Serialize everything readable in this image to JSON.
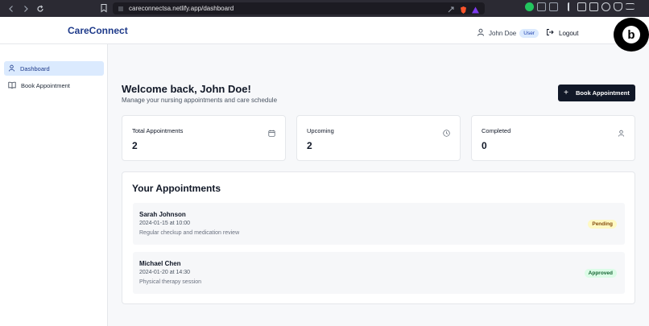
{
  "browser": {
    "url": "careconnectsa.netlify.app/dashboard"
  },
  "header": {
    "brand": "CareConnect",
    "user_name": "John Doe",
    "role": "User",
    "logout_label": "Logout"
  },
  "sidebar": {
    "items": [
      {
        "label": "Dashboard",
        "icon": "user-icon",
        "active": true
      },
      {
        "label": "Book Appointment",
        "icon": "book-icon",
        "active": false
      }
    ]
  },
  "main": {
    "welcome": "Welcome back, John Doe!",
    "subtitle": "Manage your nursing appointments and care schedule",
    "book_button": "Book Appointment",
    "stats": [
      {
        "label": "Total Appointments",
        "value": "2",
        "icon": "calendar-icon"
      },
      {
        "label": "Upcoming",
        "value": "2",
        "icon": "clock-icon"
      },
      {
        "label": "Completed",
        "value": "0",
        "icon": "user-icon"
      }
    ],
    "appointments_title": "Your Appointments",
    "appointments": [
      {
        "name": "Sarah Johnson",
        "datetime": "2024-01-15 at 10:00",
        "note": "Regular checkup and medication review",
        "status": "Pending"
      },
      {
        "name": "Michael Chen",
        "datetime": "2024-01-20 at 14:30",
        "note": "Physical therapy session",
        "status": "Approved"
      }
    ]
  },
  "colors": {
    "brand": "#1e3a8a",
    "primary_button": "#111827",
    "active_nav": "#dbeafe",
    "pending_bg": "#fef9c3",
    "approved_bg": "#dcfce7"
  }
}
